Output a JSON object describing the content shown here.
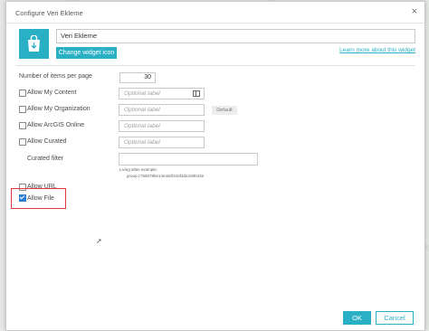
{
  "dialog": {
    "title": "Configure Veri Ekleme",
    "close_glyph": "×",
    "widget_name": "Veri Ekleme",
    "change_icon_label": "Change widget icon",
    "learn_more": "Learn more about this widget"
  },
  "settings": {
    "items_per_page_label": "Number of items per page",
    "items_per_page_value": "30",
    "rows": [
      {
        "label": "Allow My Content",
        "checked": false,
        "placeholder": "Optional label"
      },
      {
        "label": "Allow My Organization",
        "checked": false,
        "placeholder": "Optional label",
        "default_button": "Default"
      },
      {
        "label": "Allow ArcGIS Online",
        "checked": false,
        "placeholder": "Optional label"
      },
      {
        "label": "Allow Curated",
        "checked": false,
        "placeholder": "Optional label"
      }
    ],
    "curated_filter_label": "Curated filter",
    "curated_filter_value": "",
    "curated_hint_line1": "Living atlas example:",
    "curated_hint_line2": "group:c755678be14e4a0f44af3da199b43e",
    "allow_url_label": "Allow URL",
    "allow_url_checked": false,
    "allow_file_label": "Allow File",
    "allow_file_checked": true
  },
  "footer": {
    "ok_label": "OK",
    "cancel_label": "Cancel"
  },
  "colors": {
    "accent": "#2ab0c4",
    "highlight": "#e0383b",
    "checkbox": "#2a7fd4"
  },
  "icons": [
    "widget-bag-icon",
    "close-icon",
    "book-icon",
    "checkbox-check-icon",
    "mouse-cursor-icon"
  ]
}
